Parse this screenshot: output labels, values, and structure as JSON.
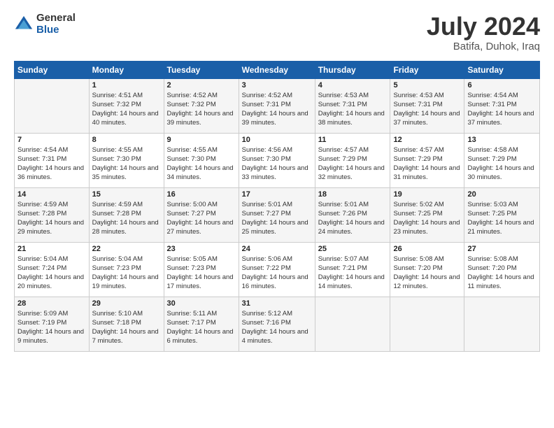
{
  "logo": {
    "general": "General",
    "blue": "Blue"
  },
  "header": {
    "month_year": "July 2024",
    "location": "Batifa, Duhok, Iraq"
  },
  "weekdays": [
    "Sunday",
    "Monday",
    "Tuesday",
    "Wednesday",
    "Thursday",
    "Friday",
    "Saturday"
  ],
  "weeks": [
    [
      {
        "day": "",
        "sunrise": "",
        "sunset": "",
        "daylight": ""
      },
      {
        "day": "1",
        "sunrise": "Sunrise: 4:51 AM",
        "sunset": "Sunset: 7:32 PM",
        "daylight": "Daylight: 14 hours and 40 minutes."
      },
      {
        "day": "2",
        "sunrise": "Sunrise: 4:52 AM",
        "sunset": "Sunset: 7:32 PM",
        "daylight": "Daylight: 14 hours and 39 minutes."
      },
      {
        "day": "3",
        "sunrise": "Sunrise: 4:52 AM",
        "sunset": "Sunset: 7:31 PM",
        "daylight": "Daylight: 14 hours and 39 minutes."
      },
      {
        "day": "4",
        "sunrise": "Sunrise: 4:53 AM",
        "sunset": "Sunset: 7:31 PM",
        "daylight": "Daylight: 14 hours and 38 minutes."
      },
      {
        "day": "5",
        "sunrise": "Sunrise: 4:53 AM",
        "sunset": "Sunset: 7:31 PM",
        "daylight": "Daylight: 14 hours and 37 minutes."
      },
      {
        "day": "6",
        "sunrise": "Sunrise: 4:54 AM",
        "sunset": "Sunset: 7:31 PM",
        "daylight": "Daylight: 14 hours and 37 minutes."
      }
    ],
    [
      {
        "day": "7",
        "sunrise": "Sunrise: 4:54 AM",
        "sunset": "Sunset: 7:31 PM",
        "daylight": "Daylight: 14 hours and 36 minutes."
      },
      {
        "day": "8",
        "sunrise": "Sunrise: 4:55 AM",
        "sunset": "Sunset: 7:30 PM",
        "daylight": "Daylight: 14 hours and 35 minutes."
      },
      {
        "day": "9",
        "sunrise": "Sunrise: 4:55 AM",
        "sunset": "Sunset: 7:30 PM",
        "daylight": "Daylight: 14 hours and 34 minutes."
      },
      {
        "day": "10",
        "sunrise": "Sunrise: 4:56 AM",
        "sunset": "Sunset: 7:30 PM",
        "daylight": "Daylight: 14 hours and 33 minutes."
      },
      {
        "day": "11",
        "sunrise": "Sunrise: 4:57 AM",
        "sunset": "Sunset: 7:29 PM",
        "daylight": "Daylight: 14 hours and 32 minutes."
      },
      {
        "day": "12",
        "sunrise": "Sunrise: 4:57 AM",
        "sunset": "Sunset: 7:29 PM",
        "daylight": "Daylight: 14 hours and 31 minutes."
      },
      {
        "day": "13",
        "sunrise": "Sunrise: 4:58 AM",
        "sunset": "Sunset: 7:29 PM",
        "daylight": "Daylight: 14 hours and 30 minutes."
      }
    ],
    [
      {
        "day": "14",
        "sunrise": "Sunrise: 4:59 AM",
        "sunset": "Sunset: 7:28 PM",
        "daylight": "Daylight: 14 hours and 29 minutes."
      },
      {
        "day": "15",
        "sunrise": "Sunrise: 4:59 AM",
        "sunset": "Sunset: 7:28 PM",
        "daylight": "Daylight: 14 hours and 28 minutes."
      },
      {
        "day": "16",
        "sunrise": "Sunrise: 5:00 AM",
        "sunset": "Sunset: 7:27 PM",
        "daylight": "Daylight: 14 hours and 27 minutes."
      },
      {
        "day": "17",
        "sunrise": "Sunrise: 5:01 AM",
        "sunset": "Sunset: 7:27 PM",
        "daylight": "Daylight: 14 hours and 25 minutes."
      },
      {
        "day": "18",
        "sunrise": "Sunrise: 5:01 AM",
        "sunset": "Sunset: 7:26 PM",
        "daylight": "Daylight: 14 hours and 24 minutes."
      },
      {
        "day": "19",
        "sunrise": "Sunrise: 5:02 AM",
        "sunset": "Sunset: 7:25 PM",
        "daylight": "Daylight: 14 hours and 23 minutes."
      },
      {
        "day": "20",
        "sunrise": "Sunrise: 5:03 AM",
        "sunset": "Sunset: 7:25 PM",
        "daylight": "Daylight: 14 hours and 21 minutes."
      }
    ],
    [
      {
        "day": "21",
        "sunrise": "Sunrise: 5:04 AM",
        "sunset": "Sunset: 7:24 PM",
        "daylight": "Daylight: 14 hours and 20 minutes."
      },
      {
        "day": "22",
        "sunrise": "Sunrise: 5:04 AM",
        "sunset": "Sunset: 7:23 PM",
        "daylight": "Daylight: 14 hours and 19 minutes."
      },
      {
        "day": "23",
        "sunrise": "Sunrise: 5:05 AM",
        "sunset": "Sunset: 7:23 PM",
        "daylight": "Daylight: 14 hours and 17 minutes."
      },
      {
        "day": "24",
        "sunrise": "Sunrise: 5:06 AM",
        "sunset": "Sunset: 7:22 PM",
        "daylight": "Daylight: 14 hours and 16 minutes."
      },
      {
        "day": "25",
        "sunrise": "Sunrise: 5:07 AM",
        "sunset": "Sunset: 7:21 PM",
        "daylight": "Daylight: 14 hours and 14 minutes."
      },
      {
        "day": "26",
        "sunrise": "Sunrise: 5:08 AM",
        "sunset": "Sunset: 7:20 PM",
        "daylight": "Daylight: 14 hours and 12 minutes."
      },
      {
        "day": "27",
        "sunrise": "Sunrise: 5:08 AM",
        "sunset": "Sunset: 7:20 PM",
        "daylight": "Daylight: 14 hours and 11 minutes."
      }
    ],
    [
      {
        "day": "28",
        "sunrise": "Sunrise: 5:09 AM",
        "sunset": "Sunset: 7:19 PM",
        "daylight": "Daylight: 14 hours and 9 minutes."
      },
      {
        "day": "29",
        "sunrise": "Sunrise: 5:10 AM",
        "sunset": "Sunset: 7:18 PM",
        "daylight": "Daylight: 14 hours and 7 minutes."
      },
      {
        "day": "30",
        "sunrise": "Sunrise: 5:11 AM",
        "sunset": "Sunset: 7:17 PM",
        "daylight": "Daylight: 14 hours and 6 minutes."
      },
      {
        "day": "31",
        "sunrise": "Sunrise: 5:12 AM",
        "sunset": "Sunset: 7:16 PM",
        "daylight": "Daylight: 14 hours and 4 minutes."
      },
      {
        "day": "",
        "sunrise": "",
        "sunset": "",
        "daylight": ""
      },
      {
        "day": "",
        "sunrise": "",
        "sunset": "",
        "daylight": ""
      },
      {
        "day": "",
        "sunrise": "",
        "sunset": "",
        "daylight": ""
      }
    ]
  ]
}
